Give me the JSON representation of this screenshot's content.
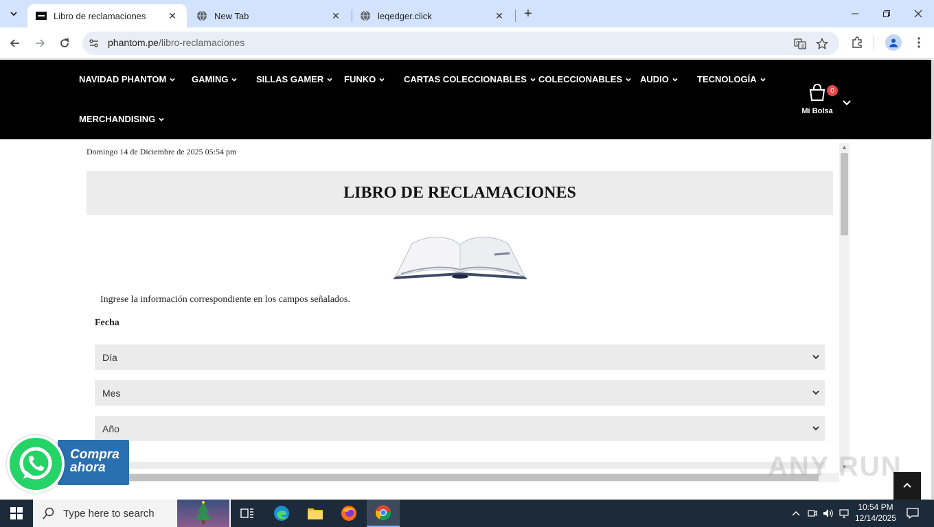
{
  "browser": {
    "tabs": [
      {
        "title": "Libro de reclamaciones",
        "active": true
      },
      {
        "title": "New Tab",
        "active": false
      },
      {
        "title": "leqedger.click",
        "active": false
      }
    ],
    "url_host": "phantom.pe",
    "url_path": "/libro-reclamaciones"
  },
  "site": {
    "menu": [
      "NAVIDAD PHANTOM",
      "GAMING",
      "SILLAS GAMER",
      "FUNKO",
      "CARTAS COLECCIONABLES",
      "COLECCIONABLES",
      "AUDIO",
      "TECNOLOGÍA",
      "MERCHANDISING"
    ],
    "cart_label": "Mi Bolsa",
    "cart_count": "0"
  },
  "page": {
    "datetime": "Domingo 14 de Diciembre de 2025  05:54 pm",
    "title": "LIBRO DE RECLAMACIONES",
    "instructions": "Ingrese la información correspondiente en los campos señalados.",
    "fecha_label": "Fecha",
    "selects": [
      "Día",
      "Mes",
      "Año"
    ]
  },
  "whatsapp": {
    "line1": "Compra",
    "line2": "ahora"
  },
  "watermark": "ANY RUN",
  "taskbar": {
    "search_placeholder": "Type here to search",
    "time": "10:54 PM",
    "date": "12/14/2025"
  },
  "colors": {
    "tabstrip": "#d3e3fd",
    "site_header": "#000000",
    "cart_badge": "#e94848",
    "whatsapp_green": "#25d366",
    "whatsapp_banner": "#2a6fb0",
    "taskbar": "#1c2a3a"
  }
}
